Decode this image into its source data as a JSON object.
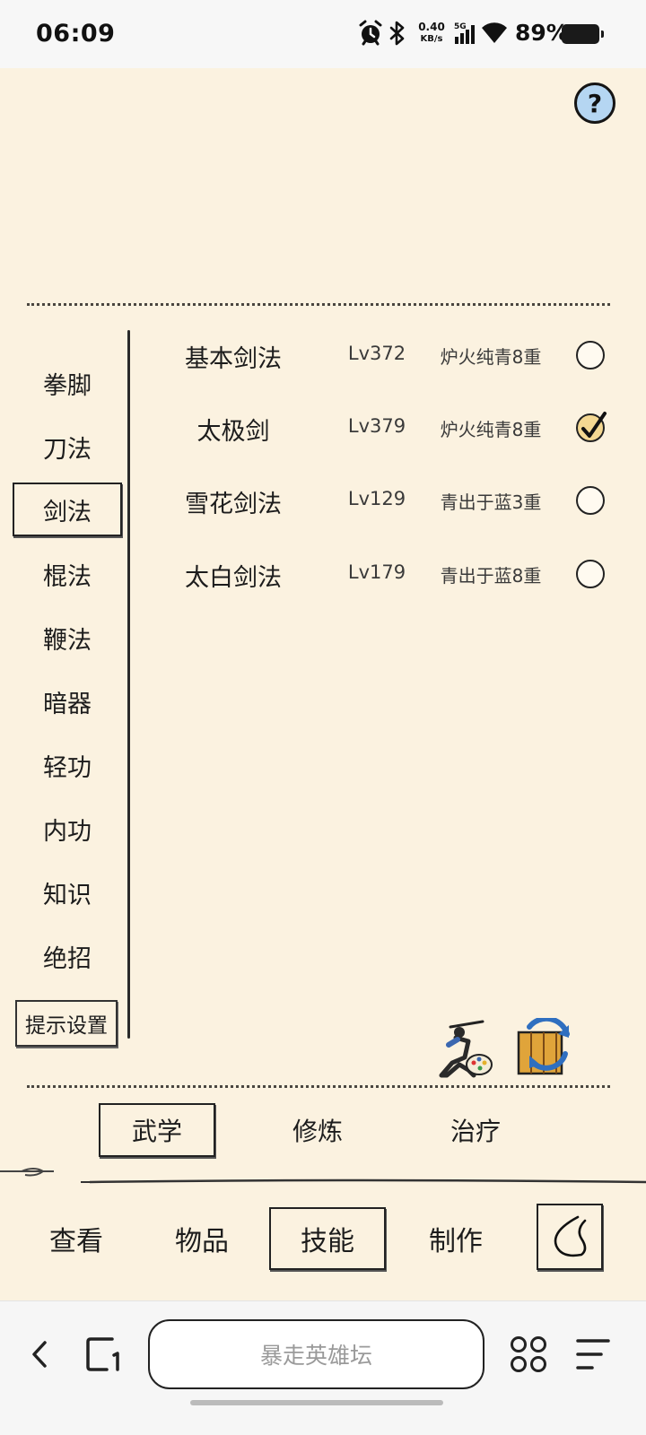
{
  "status_bar": {
    "time": "06:09",
    "net_speed_value": "0.40",
    "net_speed_unit": "KB/s",
    "network_type": "5G",
    "battery": "89%"
  },
  "help_label": "?",
  "categories": [
    {
      "label": "拳脚",
      "active": false
    },
    {
      "label": "刀法",
      "active": false
    },
    {
      "label": "剑法",
      "active": true
    },
    {
      "label": "棍法",
      "active": false
    },
    {
      "label": "鞭法",
      "active": false
    },
    {
      "label": "暗器",
      "active": false
    },
    {
      "label": "轻功",
      "active": false
    },
    {
      "label": "内功",
      "active": false
    },
    {
      "label": "知识",
      "active": false
    },
    {
      "label": "绝招",
      "active": false
    }
  ],
  "hint_settings_label": "提示设置",
  "skills": [
    {
      "name": "基本剑法",
      "level": "Lv372",
      "tier": "炉火纯青8重",
      "selected": false
    },
    {
      "name": "太极剑",
      "level": "Lv379",
      "tier": "炉火纯青8重",
      "selected": true
    },
    {
      "name": "雪花剑法",
      "level": "Lv129",
      "tier": "青出于蓝3重",
      "selected": false
    },
    {
      "name": "太白剑法",
      "level": "Lv179",
      "tier": "青出于蓝8重",
      "selected": false
    }
  ],
  "sub_tabs": [
    {
      "label": "武学",
      "active": true
    },
    {
      "label": "修炼",
      "active": false
    },
    {
      "label": "治疗",
      "active": false
    }
  ],
  "main_tabs": [
    {
      "label": "查看",
      "active": false
    },
    {
      "label": "物品",
      "active": false
    },
    {
      "label": "技能",
      "active": true
    },
    {
      "label": "制作",
      "active": false
    }
  ],
  "browser": {
    "address_text": "暴走英雄坛"
  },
  "colors": {
    "background": "#fbf2e0",
    "help_fill": "#b5d6f2",
    "checked_fill": "#f4d892"
  }
}
